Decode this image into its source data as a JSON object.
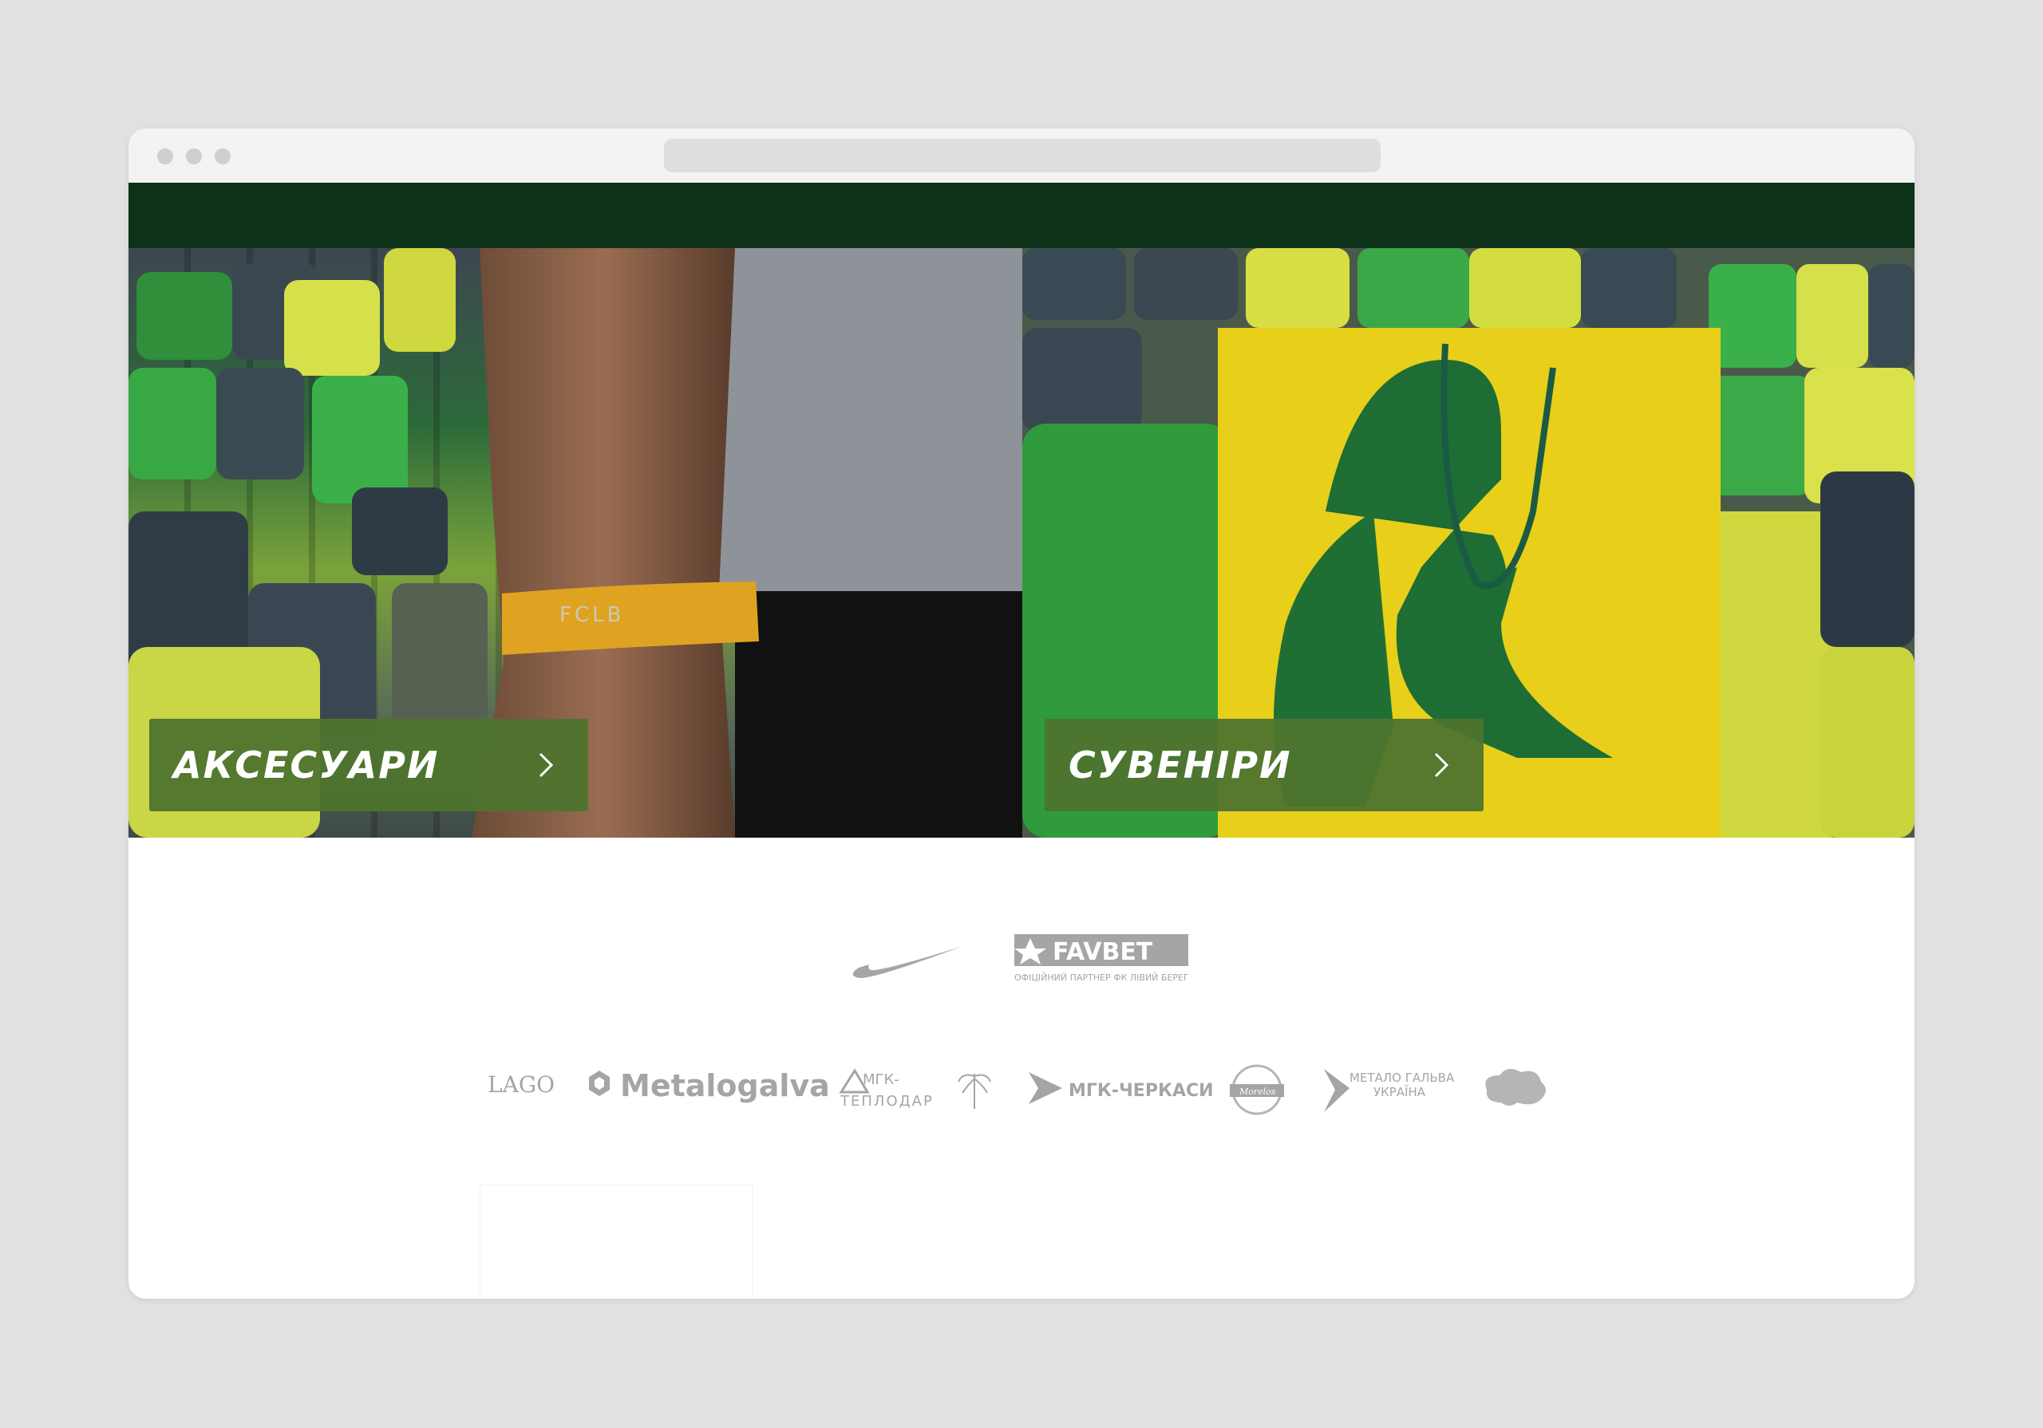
{
  "categories": [
    {
      "label": "АКСЕСУАРИ",
      "bracelet_text": "FCLB"
    },
    {
      "label": "СУВЕНІРИ"
    }
  ],
  "sponsors": {
    "main": [
      {
        "name": "Nike",
        "icon": "nike-swoosh-icon"
      },
      {
        "name": "FAVBET",
        "caption": "ОФІЦІЙНИЙ ПАРТНЕР ФК ЛІВИЙ БЕРЕГ"
      }
    ],
    "partners": [
      {
        "name": "LAGO",
        "text": "LAGO"
      },
      {
        "name": "Metalogalva",
        "text": "Metalogalva"
      },
      {
        "name": "МГК-Теплодар",
        "text_top": "МГК-",
        "text_bottom": "ТЕПЛОДАР"
      },
      {
        "name": "palm-logo",
        "text": ""
      },
      {
        "name": "МГК-Черкаси",
        "text": "МГК-ЧЕРКАСИ"
      },
      {
        "name": "Morelos",
        "text": "Morelos"
      },
      {
        "name": "Метало Гальва Україна",
        "line1": "МЕТАЛО ГАЛЬВА",
        "line2": "УКРАЇНА"
      },
      {
        "name": "cloud-logo",
        "text": ""
      }
    ]
  },
  "colors": {
    "background": "#e1e1e1",
    "topbar": "#0d3119",
    "card": "#4e742e",
    "logo_gray": "#a5a5a5"
  }
}
